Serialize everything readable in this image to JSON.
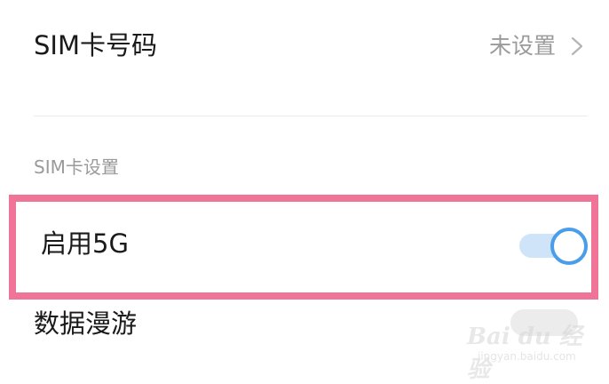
{
  "sim_number": {
    "label": "SIM卡号码",
    "value": "未设置"
  },
  "section": {
    "header": "SIM卡设置"
  },
  "enable_5g": {
    "label": "启用5G",
    "enabled": true
  },
  "data_roaming": {
    "label": "数据漫游",
    "enabled": false
  },
  "watermark": {
    "brand": "Bai du 经验",
    "site": "jingyan.baidu.com"
  },
  "colors": {
    "highlight": "#f07497",
    "toggle_on_knob": "#4a9de8",
    "toggle_on_track": "#cfe4f8"
  }
}
